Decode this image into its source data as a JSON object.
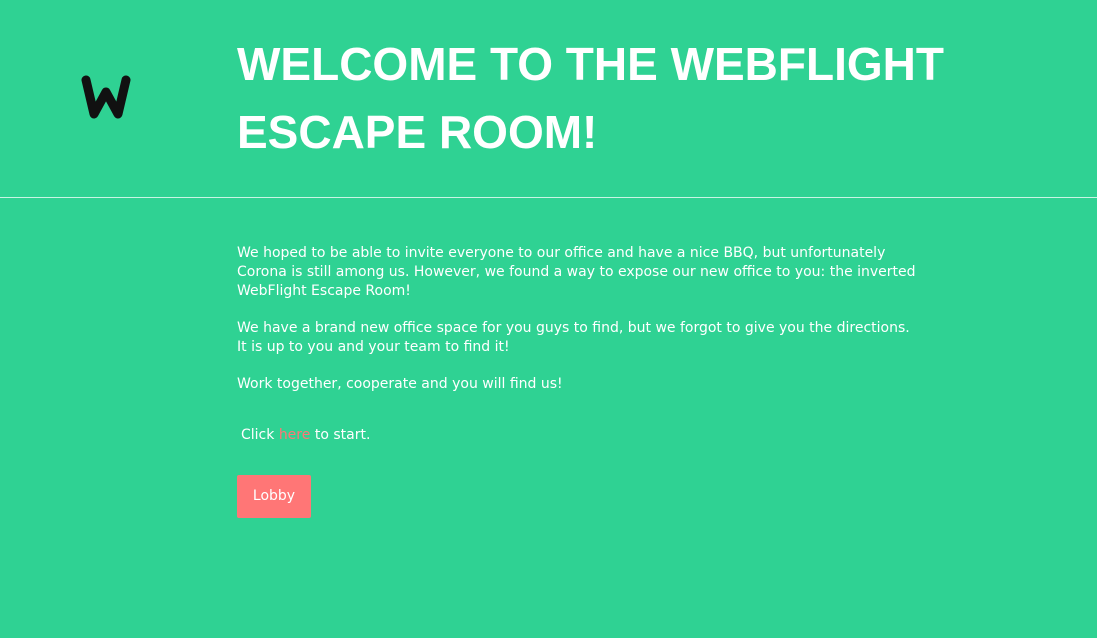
{
  "header": {
    "title": "WELCOME TO THE WEBFLIGHT ESCAPE ROOM!",
    "logo_icon": "webflight-w-logo-icon"
  },
  "content": {
    "paragraphs": [
      "We hoped to be able to invite everyone to our office and have a nice BBQ, but unfortunately Corona is still among us. However, we found a way to expose our new office to you: the inverted WebFlight Escape Room!",
      "We have a brand new office space for you guys to find, but we forgot to give you the directions. It is up to you and your team to find it!",
      "Work together, cooperate and you will find us!"
    ]
  },
  "cta": {
    "prefix": "Click ",
    "link_label": "here",
    "suffix": " to start."
  },
  "lobby_button": {
    "label": "Lobby"
  },
  "colors": {
    "background": "#2fd293",
    "accent": "#ff7676",
    "text": "#ffffff",
    "logo": "#111111"
  }
}
